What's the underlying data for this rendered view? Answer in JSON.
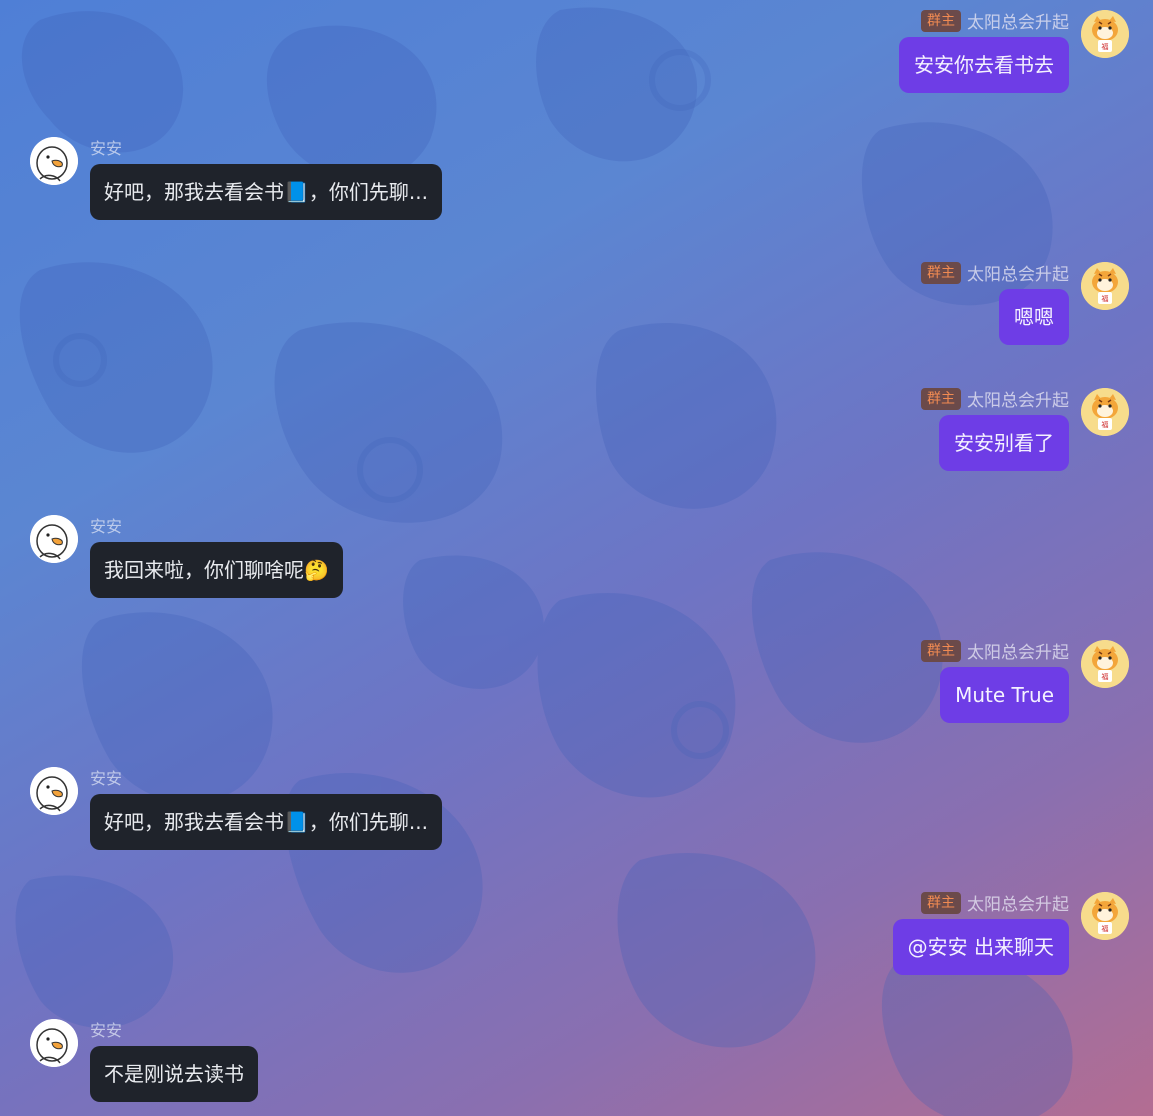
{
  "messages": [
    {
      "side": "right",
      "badge": "群主",
      "name": "太阳总会升起",
      "text": "安安你去看书去",
      "avatar": "tiger-avatar"
    },
    {
      "side": "left",
      "name": "安安",
      "text": "好吧，那我去看会书📘，你们先聊...",
      "avatar": "duck-avatar"
    },
    {
      "side": "right",
      "badge": "群主",
      "name": "太阳总会升起",
      "text": "嗯嗯",
      "avatar": "tiger-avatar"
    },
    {
      "side": "right",
      "badge": "群主",
      "name": "太阳总会升起",
      "text": "安安别看了",
      "avatar": "tiger-avatar"
    },
    {
      "side": "left",
      "name": "安安",
      "text": "我回来啦，你们聊啥呢🤔",
      "avatar": "duck-avatar"
    },
    {
      "side": "right",
      "badge": "群主",
      "name": "太阳总会升起",
      "text": "Mute True",
      "avatar": "tiger-avatar"
    },
    {
      "side": "left",
      "name": "安安",
      "text": "好吧，那我去看会书📘，你们先聊...",
      "avatar": "duck-avatar"
    },
    {
      "side": "right",
      "badge": "群主",
      "name": "太阳总会升起",
      "text": "@安安 出来聊天",
      "avatar": "tiger-avatar"
    },
    {
      "side": "left",
      "name": "安安",
      "text": "不是刚说去读书",
      "avatar": "duck-avatar"
    }
  ],
  "colors": {
    "outgoing_bubble": "#6e3de6",
    "incoming_bubble": "#1f232b",
    "badge_bg": "#6b4a4a",
    "badge_text": "#f08a52"
  }
}
